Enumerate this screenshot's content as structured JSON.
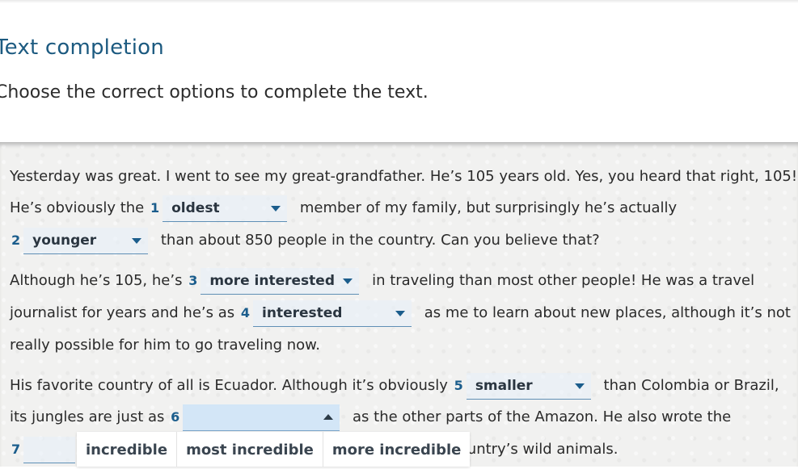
{
  "header": {
    "title": "Text completion",
    "instruction": "Choose the correct options to complete the text."
  },
  "passage": {
    "line1": "Yesterday was great. I went to see my great-grandfather. He’s 105 years old. Yes, you heard that right, 105!",
    "line2_pre": "He’s obviously the",
    "line2_post": "member of my family, but surprisingly he’s actually",
    "line3_post": "than about 850 people in the country. Can you believe that?",
    "line4_pre": "Although he’s 105, he’s",
    "line4_post": "in traveling than most other people! He was a travel",
    "line5_pre": "journalist for years and he’s as",
    "line5_post": "as me to learn about new places, although it’s not",
    "line6": "really possible for him to go traveling now.",
    "line7_pre": "His favorite country of all is Ecuador. Although it’s obviously",
    "line7_post": "than Colombia or Brazil,",
    "line8_pre": "its jungles are just as",
    "line8_post": "as the other parts of the Amazon. He also wrote the",
    "line9_post": "country’s wild animals."
  },
  "blanks": [
    {
      "number": "1",
      "value": "oldest"
    },
    {
      "number": "2",
      "value": "younger"
    },
    {
      "number": "3",
      "value": "more interested"
    },
    {
      "number": "4",
      "value": "interested"
    },
    {
      "number": "5",
      "value": "smaller"
    },
    {
      "number": "6",
      "value": ""
    },
    {
      "number": "7",
      "value": ""
    }
  ],
  "open_dropdown": {
    "blank": "6",
    "options": [
      "incredible",
      "most incredible",
      "more incredible"
    ]
  }
}
